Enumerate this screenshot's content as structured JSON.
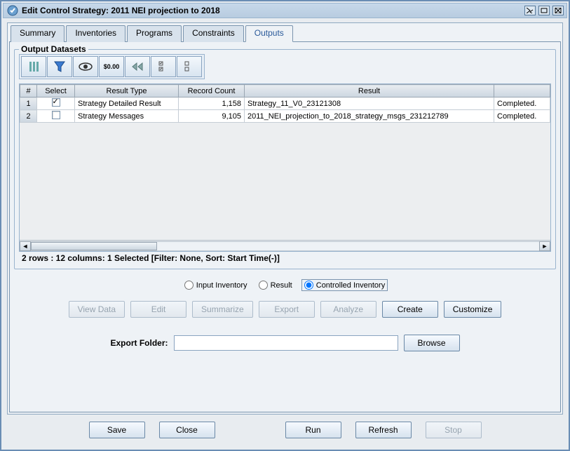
{
  "window": {
    "title": "Edit Control Strategy: 2011 NEI projection to 2018"
  },
  "tabs": {
    "summary": "Summary",
    "inventories": "Inventories",
    "programs": "Programs",
    "constraints": "Constraints",
    "outputs": "Outputs"
  },
  "outputs": {
    "legend": "Output Datasets",
    "toolbar_icons": [
      "refresh-icon",
      "filter-icon",
      "view-icon",
      "format-icon",
      "first-icon",
      "selectall-icon",
      "selectnone-icon"
    ],
    "columns": {
      "num": "#",
      "select": "Select",
      "result_type": "Result Type",
      "record_count": "Record Count",
      "result": "Result",
      "status": ""
    },
    "rows": [
      {
        "num": "1",
        "selected": true,
        "result_type": "Strategy Detailed Result",
        "record_count": "1,158",
        "result": "Strategy_11_V0_23121308",
        "status": "Completed."
      },
      {
        "num": "2",
        "selected": false,
        "result_type": "Strategy Messages",
        "record_count": "9,105",
        "result": "2011_NEI_projection_to_2018_strategy_msgs_231212789",
        "status": "Completed."
      }
    ],
    "status": "2 rows : 12 columns: 1 Selected [Filter: None, Sort: Start Time(-)]"
  },
  "radios": {
    "input_inv": "Input Inventory",
    "result": "Result",
    "controlled_inv": "Controlled Inventory",
    "selected": "controlled_inv"
  },
  "actions": {
    "view_data": "View Data",
    "edit": "Edit",
    "summarize": "Summarize",
    "export": "Export",
    "analyze": "Analyze",
    "create": "Create",
    "customize": "Customize"
  },
  "export_folder": {
    "label": "Export Folder:",
    "value": "",
    "browse": "Browse"
  },
  "footer": {
    "save": "Save",
    "close": "Close",
    "run": "Run",
    "refresh": "Refresh",
    "stop": "Stop"
  }
}
